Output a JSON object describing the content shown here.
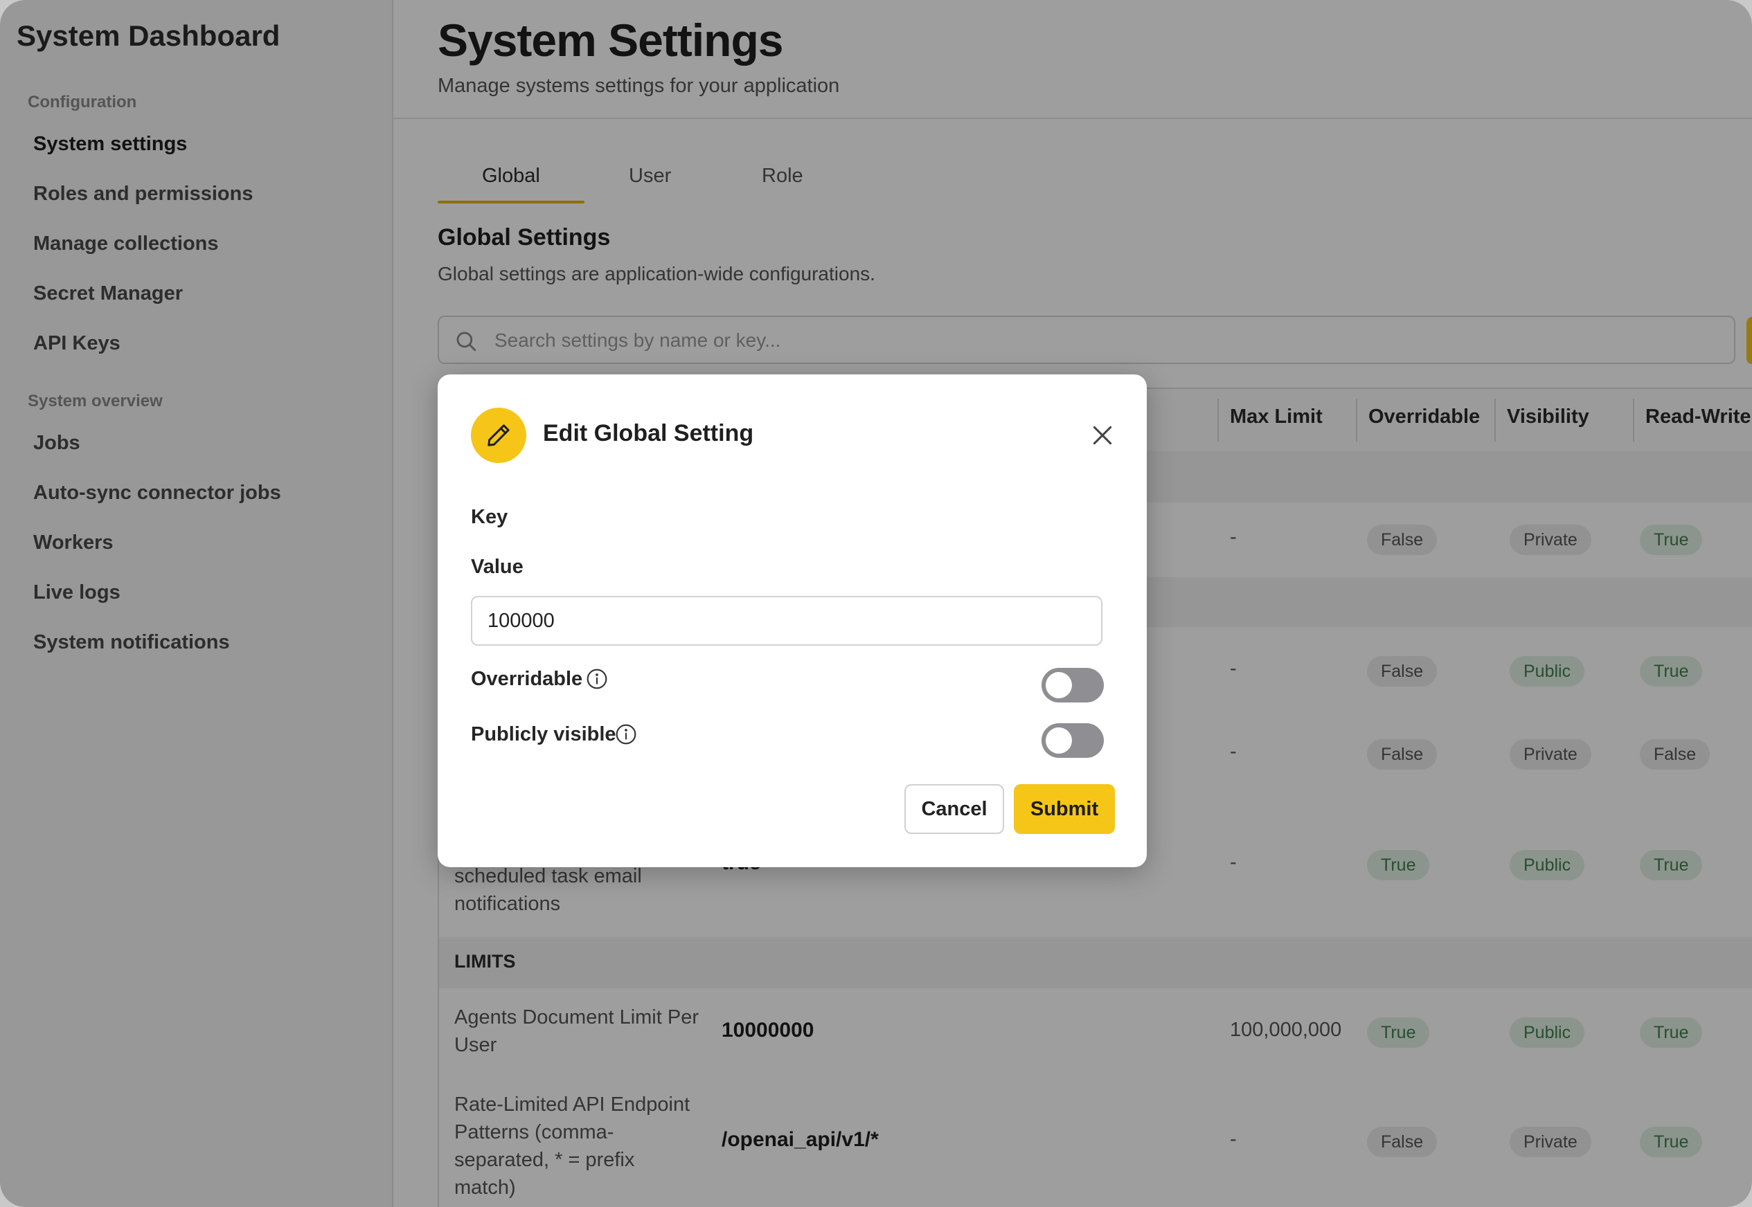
{
  "sidebar": {
    "title": "System Dashboard",
    "sections": [
      {
        "label": "Configuration",
        "items": [
          {
            "label": "System settings",
            "active": true
          },
          {
            "label": "Roles and permissions"
          },
          {
            "label": "Manage collections"
          },
          {
            "label": "Secret Manager"
          },
          {
            "label": "API Keys"
          }
        ]
      },
      {
        "label": "System overview",
        "items": [
          {
            "label": "Jobs"
          },
          {
            "label": "Auto-sync connector jobs"
          },
          {
            "label": "Workers"
          },
          {
            "label": "Live logs"
          },
          {
            "label": "System notifications"
          }
        ]
      }
    ]
  },
  "header": {
    "title": "System Settings",
    "subtitle": "Manage systems settings for your application"
  },
  "tabs": [
    {
      "label": "Global",
      "active": true
    },
    {
      "label": "User"
    },
    {
      "label": "Role"
    }
  ],
  "global_settings": {
    "title": "Global Settings",
    "subtitle": "Global settings are application-wide configurations.",
    "search_placeholder": "Search settings by name or key..."
  },
  "table": {
    "columns": {
      "max_limit": "Max Limit",
      "overridable": "Overridable",
      "visibility": "Visibility",
      "read_write": "Read-Write"
    },
    "rows": [
      {
        "max": "-",
        "overridable": "False",
        "visibility": "Private",
        "read_write": "True"
      },
      {
        "max": "-",
        "overridable": "False",
        "visibility": "Public",
        "read_write": "True"
      },
      {
        "max": "-",
        "overridable": "False",
        "visibility": "Private",
        "read_write": "False"
      },
      {
        "name_line1": "scheduled task email",
        "name_line2": "notifications",
        "value": "true",
        "max": "-",
        "overridable": "True",
        "visibility": "Public",
        "read_write": "True"
      }
    ],
    "group_limits": "LIMITS",
    "limit_rows": [
      {
        "name_line1": "Agents Document Limit Per",
        "name_line2": "User",
        "value": "10000000",
        "max": "100,000,000",
        "overridable": "True",
        "visibility": "Public",
        "read_write": "True"
      },
      {
        "name_line1": "Rate-Limited API Endpoint",
        "name_line2": "Patterns (comma-",
        "name_line3": "separated, * = prefix",
        "name_line4": "match)",
        "value": "/openai_api/v1/*",
        "max": "-",
        "overridable": "False",
        "visibility": "Private",
        "read_write": "True"
      }
    ]
  },
  "modal": {
    "title": "Edit Global Setting",
    "key_label": "Key",
    "value_label": "Value",
    "value": "100000",
    "overridable_label": "Overridable",
    "overridable_on": false,
    "public_label": "Publicly visible",
    "public_on": false,
    "cancel_label": "Cancel",
    "submit_label": "Submit"
  },
  "colors": {
    "accent": "#f5c518",
    "pill_green_bg": "#e2f1e4",
    "pill_green_text": "#3f7f4c",
    "pill_grey_bg": "#ececec"
  }
}
